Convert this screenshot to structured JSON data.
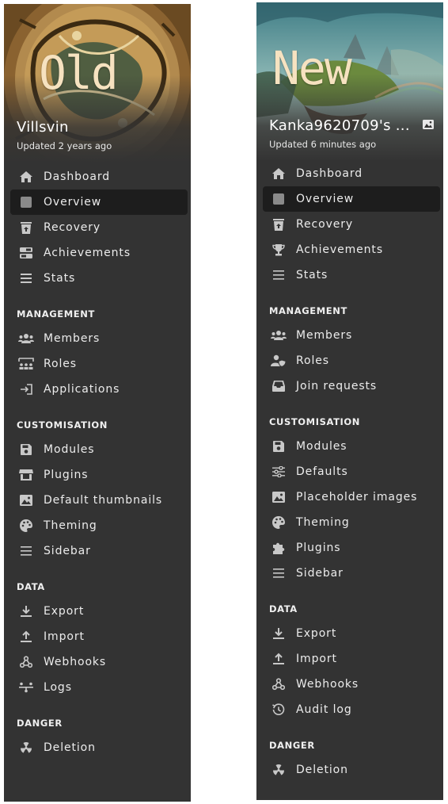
{
  "old": {
    "overlay_label": "Old",
    "campaign_name": "Villsvin",
    "updated": "Updated 2 years ago",
    "top_items": [
      {
        "label": "Dashboard",
        "icon": "home-icon"
      },
      {
        "label": "Overview",
        "icon": "square-icon",
        "active": true
      },
      {
        "label": "Recovery",
        "icon": "trash-restore-icon"
      },
      {
        "label": "Achievements",
        "icon": "toggle-icon"
      },
      {
        "label": "Stats",
        "icon": "list-icon"
      }
    ],
    "sections": [
      {
        "title": "MANAGEMENT",
        "items": [
          {
            "label": "Members",
            "icon": "users-icon"
          },
          {
            "label": "Roles",
            "icon": "people-roof-icon"
          },
          {
            "label": "Applications",
            "icon": "sign-in-icon"
          }
        ]
      },
      {
        "title": "CUSTOMISATION",
        "items": [
          {
            "label": "Modules",
            "icon": "floppy-icon"
          },
          {
            "label": "Plugins",
            "icon": "shop-icon"
          },
          {
            "label": "Default thumbnails",
            "icon": "image-icon"
          },
          {
            "label": "Theming",
            "icon": "palette-icon"
          },
          {
            "label": "Sidebar",
            "icon": "bars-icon"
          }
        ]
      },
      {
        "title": "DATA",
        "items": [
          {
            "label": "Export",
            "icon": "download-icon"
          },
          {
            "label": "Import",
            "icon": "upload-icon"
          },
          {
            "label": "Webhooks",
            "icon": "webhook-icon"
          },
          {
            "label": "Logs",
            "icon": "logs-icon"
          }
        ]
      },
      {
        "title": "DANGER",
        "items": [
          {
            "label": "Deletion",
            "icon": "radiation-icon"
          }
        ]
      }
    ]
  },
  "new": {
    "overlay_label": "New",
    "campaign_name": "Kanka9620709's ...",
    "updated": "Updated 6 minutes ago",
    "top_items": [
      {
        "label": "Dashboard",
        "icon": "home-icon"
      },
      {
        "label": "Overview",
        "icon": "square-icon",
        "active": true
      },
      {
        "label": "Recovery",
        "icon": "trash-restore-icon"
      },
      {
        "label": "Achievements",
        "icon": "trophy-icon"
      },
      {
        "label": "Stats",
        "icon": "list-icon"
      }
    ],
    "sections": [
      {
        "title": "MANAGEMENT",
        "items": [
          {
            "label": "Members",
            "icon": "users-icon"
          },
          {
            "label": "Roles",
            "icon": "user-shield-icon"
          },
          {
            "label": "Join requests",
            "icon": "inbox-icon"
          }
        ]
      },
      {
        "title": "CUSTOMISATION",
        "items": [
          {
            "label": "Modules",
            "icon": "floppy-icon"
          },
          {
            "label": "Defaults",
            "icon": "sliders-icon"
          },
          {
            "label": "Placeholder images",
            "icon": "image-icon"
          },
          {
            "label": "Theming",
            "icon": "palette-icon"
          },
          {
            "label": "Plugins",
            "icon": "puzzle-icon"
          },
          {
            "label": "Sidebar",
            "icon": "bars-icon"
          }
        ]
      },
      {
        "title": "DATA",
        "items": [
          {
            "label": "Export",
            "icon": "download-icon"
          },
          {
            "label": "Import",
            "icon": "upload-icon"
          },
          {
            "label": "Webhooks",
            "icon": "webhook-icon"
          },
          {
            "label": "Audit log",
            "icon": "history-icon"
          }
        ]
      },
      {
        "title": "DANGER",
        "items": [
          {
            "label": "Deletion",
            "icon": "radiation-icon"
          }
        ]
      }
    ]
  },
  "colors": {
    "panel_bg": "#333333",
    "active_bg": "#1d1d1d",
    "text": "#ececec",
    "icon": "#c8c8c8",
    "overlay_text": "#f6e2c0"
  }
}
